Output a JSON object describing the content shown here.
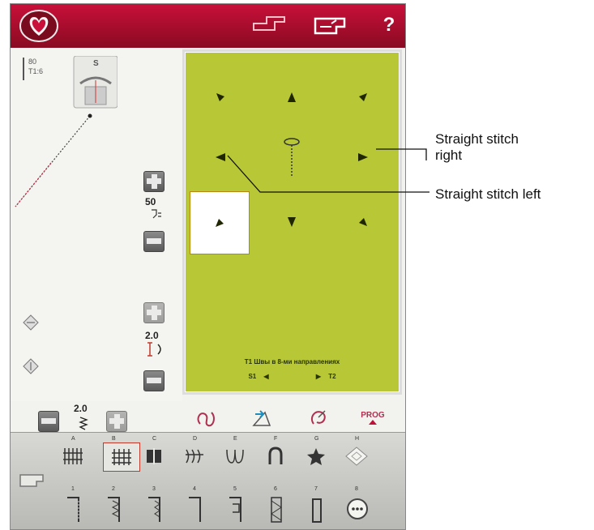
{
  "top_bar": {
    "help_label": "?"
  },
  "left_panel": {
    "needle_label": "80",
    "thread_label": "T1:6",
    "foot_letter": "S",
    "foot_tension": "50",
    "stitch_width": "2.0",
    "stitch_length": "2.0"
  },
  "stitch_panel": {
    "caption": "T1 Швы в 8-ми направлениях",
    "left_label": "S1",
    "right_label": "T2"
  },
  "menu_bar": {
    "categories": [
      {
        "letter": "A"
      },
      {
        "letter": "B"
      },
      {
        "letter": "C"
      },
      {
        "letter": "D"
      },
      {
        "letter": "E"
      },
      {
        "letter": "F"
      },
      {
        "letter": "G"
      },
      {
        "letter": "H"
      }
    ],
    "stitches": [
      {
        "number": "1"
      },
      {
        "number": "2"
      },
      {
        "number": "3"
      },
      {
        "number": "4"
      },
      {
        "number": "5"
      },
      {
        "number": "6"
      },
      {
        "number": "7"
      },
      {
        "number": "8"
      }
    ],
    "prog_label": "PROG"
  },
  "callouts": {
    "right_line1": "Straight stitch",
    "right_line2": "right",
    "left": "Straight stitch left"
  },
  "colors": {
    "top_bar": "#c8103a",
    "stitch_panel": "#b7c735",
    "selection": "#c0392b"
  }
}
